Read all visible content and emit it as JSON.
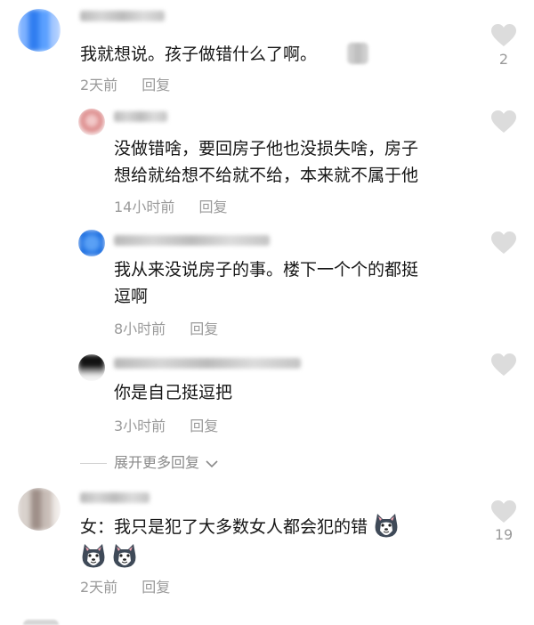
{
  "comments": [
    {
      "text": "我就想说。孩子做错什么了啊。",
      "time": "2天前",
      "reply_label": "回复",
      "like_count": "2",
      "avatar_color": "#3a86f5"
    },
    {
      "text_line1": "没做错啥，要回房子他也没损失啥，房子",
      "text_line2": "想给就给想不给就不给，本来就不属于他",
      "time": "14小时前",
      "reply_label": "回复",
      "avatar_color": "#e9a3a3"
    },
    {
      "text_line1": "我从来没说房子的事。楼下一个个的都挺",
      "text_line2": "逗啊",
      "time": "8小时前",
      "reply_label": "回复",
      "avatar_color": "#2f7de0"
    },
    {
      "text": "你是自己挺逗把",
      "time": "3小时前",
      "reply_label": "回复",
      "avatar_color": "#1f1f1f"
    },
    {
      "text": "女：我只是犯了大多数女人都会犯的错",
      "time": "2天前",
      "reply_label": "回复",
      "like_count": "19",
      "avatar_color": "#c8c0bb"
    }
  ],
  "expand_label": "展开更多回复",
  "colors": {
    "meta": "#9a9a9a",
    "like_icon": "#dcdcdc"
  },
  "icons": [
    "heart-icon",
    "chevron-down-icon",
    "husky-sticker"
  ]
}
